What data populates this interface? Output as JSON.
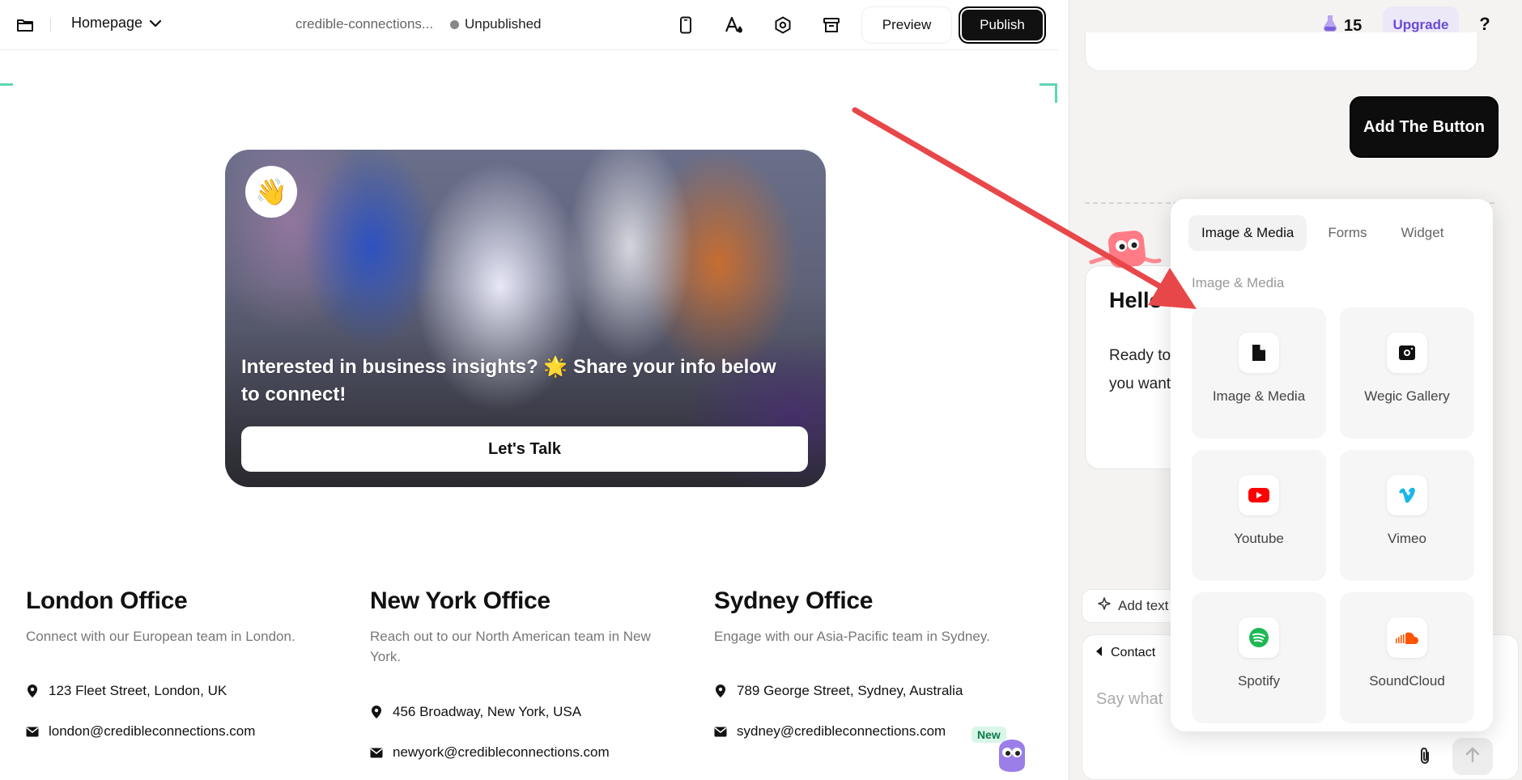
{
  "topbar": {
    "page_name": "Homepage",
    "slug": "credible-connections...",
    "status": "Unpublished",
    "preview_label": "Preview",
    "publish_label": "Publish"
  },
  "hero": {
    "wave_emoji": "👋",
    "text": "Interested in business insights? 🌟 Share your info below to connect!",
    "button_label": "Let's Talk"
  },
  "offices": [
    {
      "title": "London Office",
      "description": "Connect with our European team in London.",
      "address": "123 Fleet Street, London, UK",
      "email": "london@credibleconnections.com"
    },
    {
      "title": "New York Office",
      "description": "Reach out to our North American team in New York.",
      "address": "456 Broadway, New York, USA",
      "email": "newyork@credibleconnections.com"
    },
    {
      "title": "Sydney Office",
      "description": "Engage with our Asia-Pacific team in Sydney.",
      "address": "789 George Street, Sydney, Australia",
      "email": "sydney@credibleconnections.com"
    }
  ],
  "new_badge": "New",
  "panel": {
    "credits": "15",
    "upgrade_label": "Upgrade",
    "help_label": "?",
    "add_button_label": "Add The Button",
    "chat_title": "Hello",
    "chat_body": "Ready to you want",
    "add_text_label": "Add text",
    "contact_label": "Contact",
    "input_placeholder": "Say what"
  },
  "popover": {
    "tabs": [
      "Image & Media",
      "Forms",
      "Widget"
    ],
    "active_tab": "Image & Media",
    "section_label": "Image & Media",
    "items": [
      {
        "label": "Image & Media",
        "icon": "file-icon"
      },
      {
        "label": "Wegic Gallery",
        "icon": "gallery-icon"
      },
      {
        "label": "Youtube",
        "icon": "youtube-icon"
      },
      {
        "label": "Vimeo",
        "icon": "vimeo-icon"
      },
      {
        "label": "Spotify",
        "icon": "spotify-icon"
      },
      {
        "label": "SoundCloud",
        "icon": "soundcloud-icon"
      }
    ]
  },
  "colors": {
    "accent_green": "#5ed6b3",
    "arrow_red": "#e8474a",
    "upgrade_purple": "#6b4bd6",
    "youtube_red": "#ff0000",
    "vimeo_blue": "#1ab7ea",
    "spotify_green": "#1db954",
    "soundcloud_orange": "#ff5500"
  }
}
